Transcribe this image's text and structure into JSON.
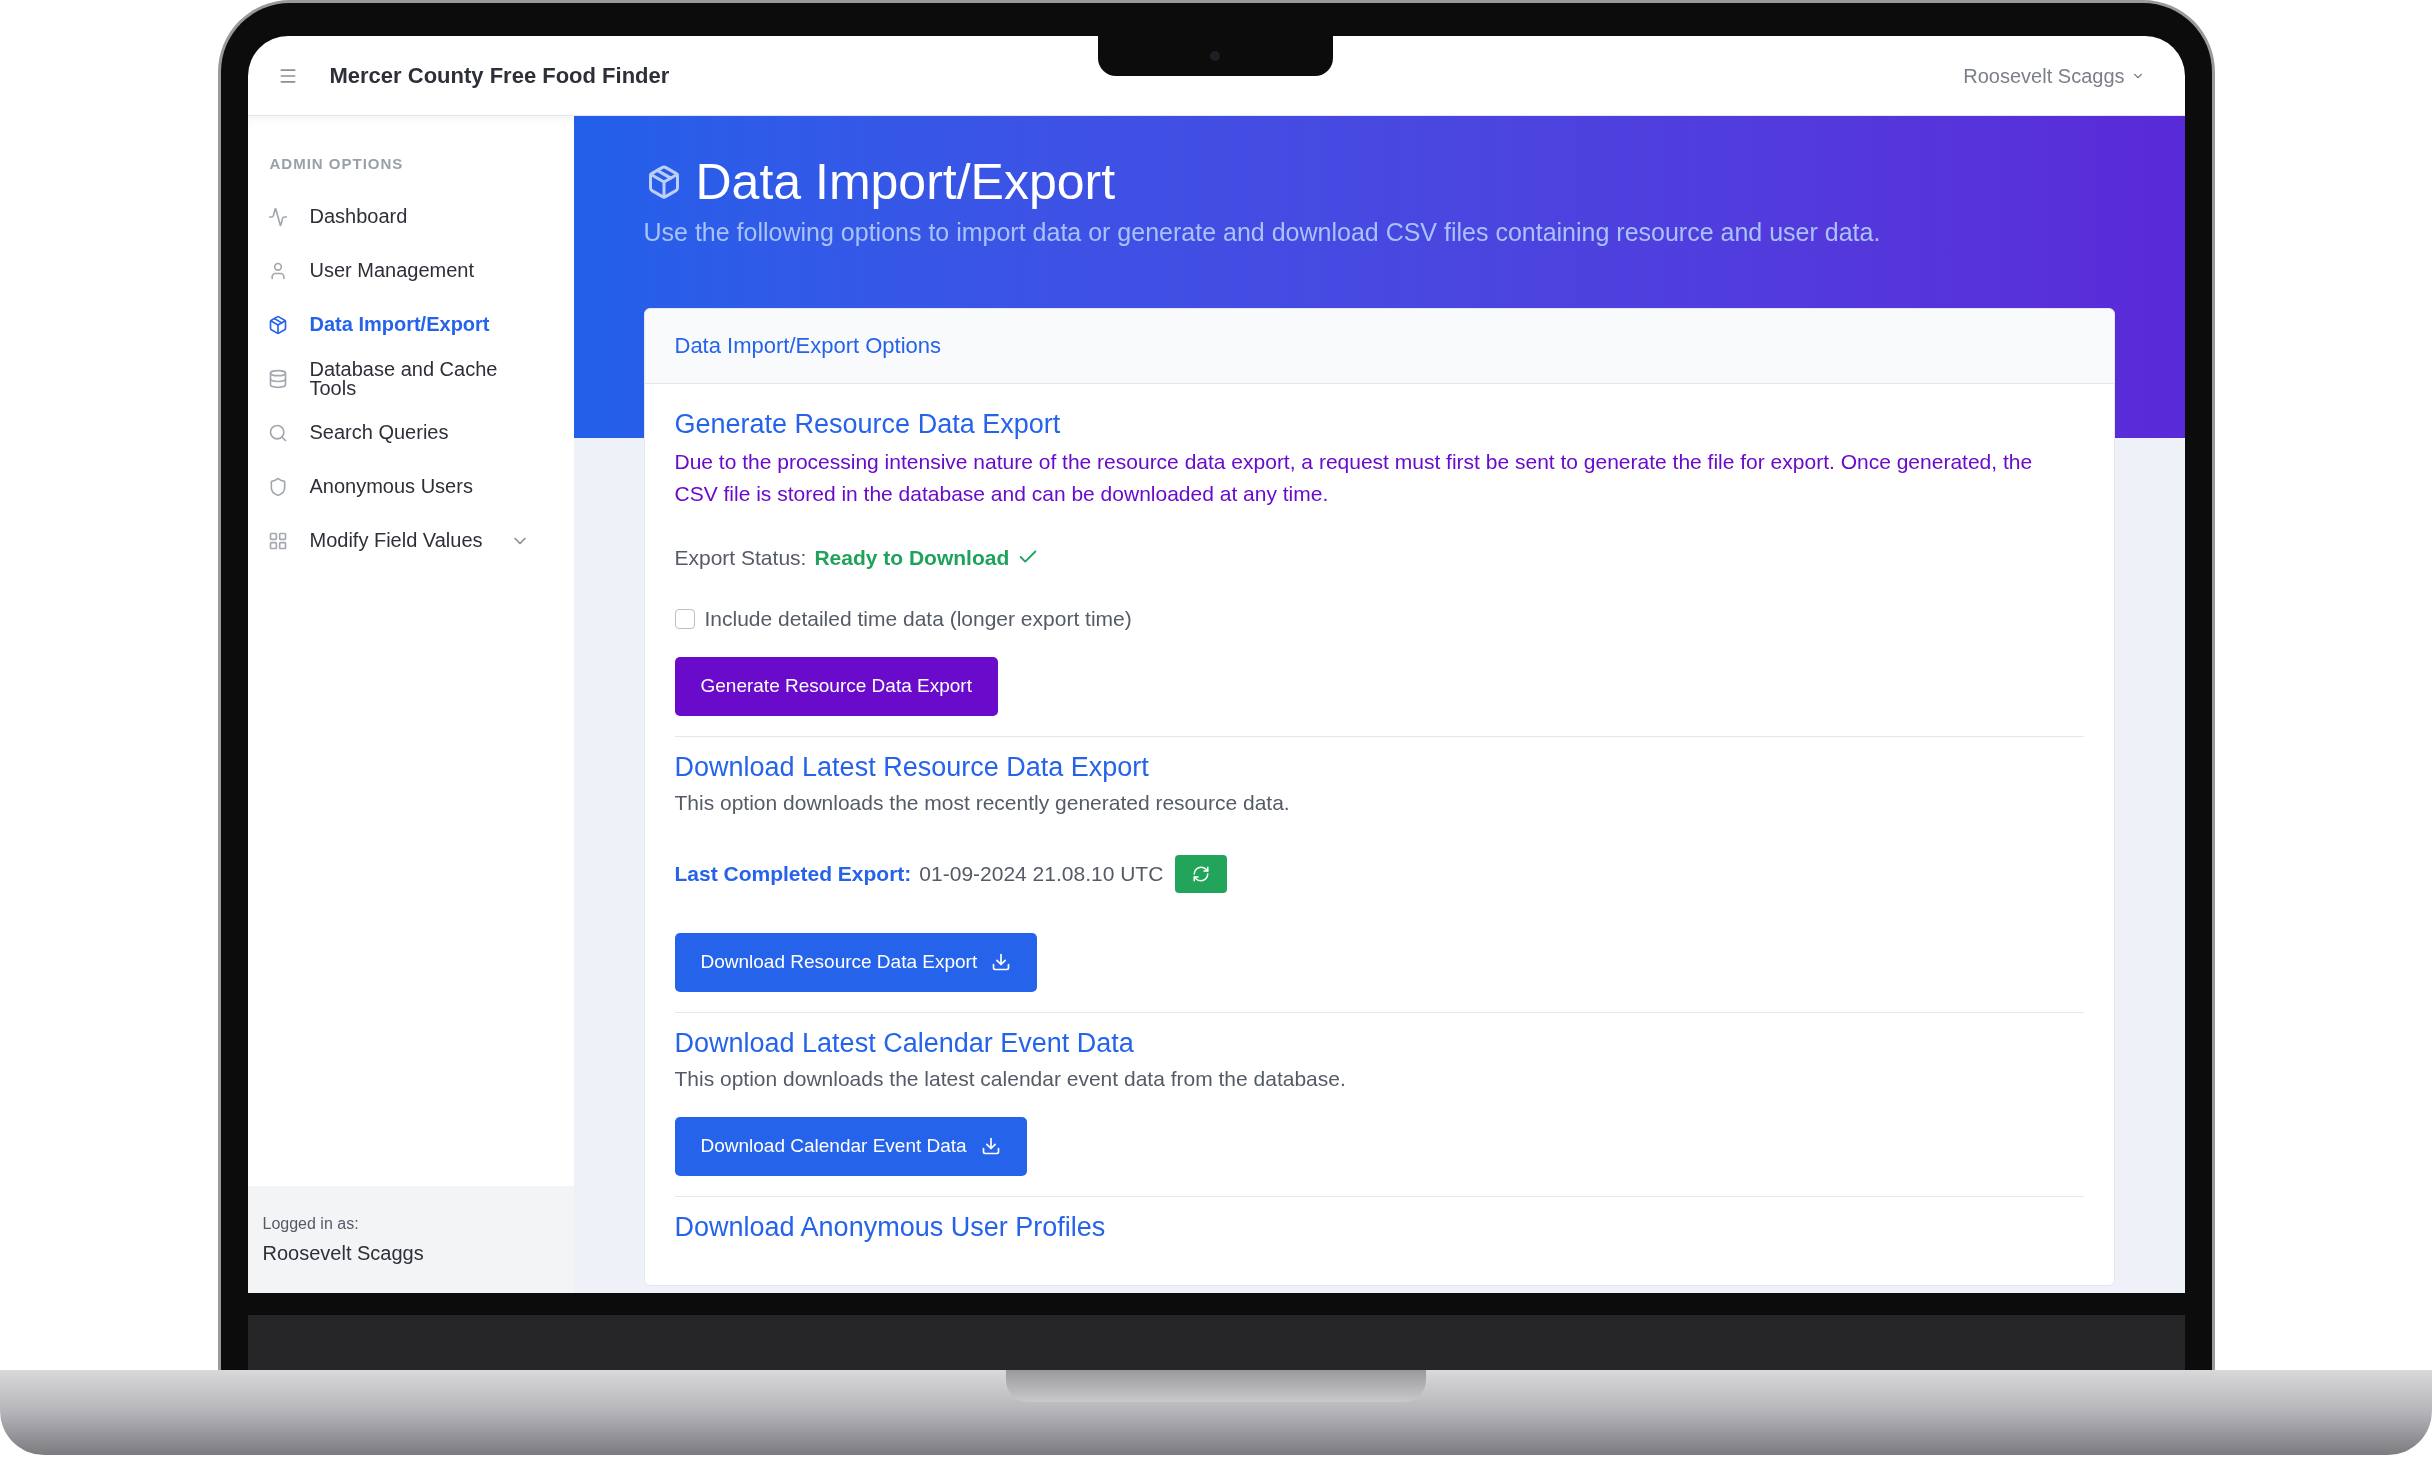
{
  "app": {
    "title": "Mercer County Free Food Finder",
    "user": "Roosevelt Scaggs"
  },
  "sidebar": {
    "section": "ADMIN OPTIONS",
    "items": [
      {
        "label": "Dashboard",
        "selected": false,
        "has_submenu": false
      },
      {
        "label": "User Management",
        "selected": false,
        "has_submenu": false
      },
      {
        "label": "Data Import/Export",
        "selected": true,
        "has_submenu": false
      },
      {
        "label": "Database and Cache Tools",
        "selected": false,
        "has_submenu": false
      },
      {
        "label": "Search Queries",
        "selected": false,
        "has_submenu": false
      },
      {
        "label": "Anonymous Users",
        "selected": false,
        "has_submenu": false
      },
      {
        "label": "Modify Field Values",
        "selected": false,
        "has_submenu": true
      }
    ],
    "footer": {
      "caption": "Logged in as:",
      "name": "Roosevelt Scaggs"
    }
  },
  "page": {
    "title": "Data Import/Export",
    "subtitle": "Use the following options to import data or generate and download CSV files containing resource and user data."
  },
  "card": {
    "header": "Data Import/Export Options",
    "sections": [
      {
        "heading": "Generate Resource Data Export",
        "note": "Due to the processing intensive nature of the resource data export, a request must first be sent to generate the file for export. Once generated, the CSV file is stored in the database and can be downloaded at any time.",
        "status": {
          "label": "Export Status:",
          "value": "Ready to Download",
          "ready": true
        },
        "checkbox": {
          "label": "Include detailed time data (longer export time)",
          "checked": false
        },
        "button": {
          "label": "Generate Resource Data Export",
          "color": "#6a0bcc",
          "download": false
        }
      },
      {
        "heading": "Download Latest Resource Data Export",
        "description": "This option downloads the most recently generated resource data.",
        "last_export": {
          "label": "Last Completed Export:",
          "value": "01-09-2024 21.08.10 UTC"
        },
        "button": {
          "label": "Download Resource Data Export",
          "color": "#2563eb",
          "download": true
        }
      },
      {
        "heading": "Download Latest Calendar Event Data",
        "description": "This option downloads the latest calendar event data from the database.",
        "button": {
          "label": "Download Calendar Event Data",
          "color": "#2563eb",
          "download": true
        }
      },
      {
        "heading": "Download Anonymous User Profiles"
      }
    ]
  }
}
